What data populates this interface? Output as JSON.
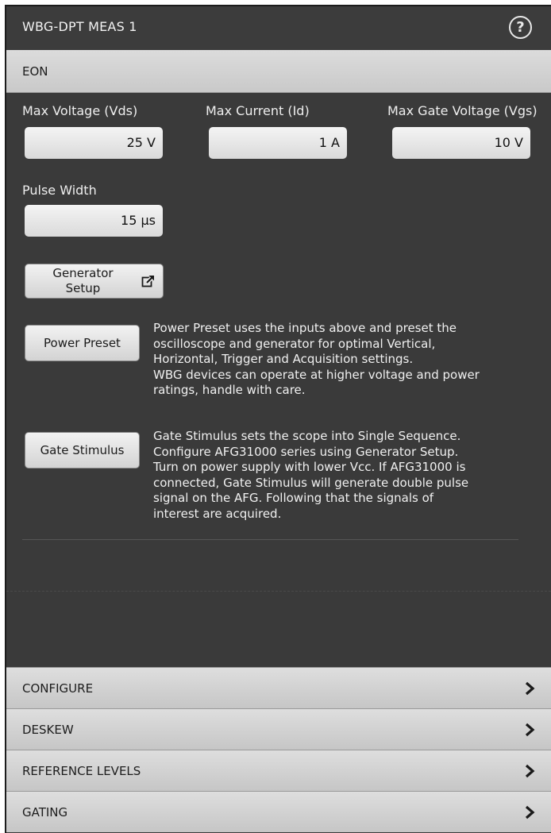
{
  "window": {
    "title": "WBG-DPT MEAS 1",
    "help_icon": "help-circle-icon"
  },
  "section": {
    "title": "EON"
  },
  "fields": {
    "max_voltage": {
      "label": "Max Voltage (Vds)",
      "value": "25 V"
    },
    "max_current": {
      "label": "Max Current (Id)",
      "value": "1 A"
    },
    "max_gate_voltage": {
      "label": "Max Gate Voltage (Vgs)",
      "value": "10 V"
    },
    "pulse_width": {
      "label": "Pulse Width",
      "value": "15 µs"
    }
  },
  "buttons": {
    "generator_setup": {
      "line1": "Generator",
      "line2": "Setup",
      "icon": "external-link-icon"
    },
    "power_preset": {
      "label": "Power Preset"
    },
    "gate_stimulus": {
      "label": "Gate Stimulus"
    }
  },
  "descriptions": {
    "power_preset": [
      "Power Preset uses the inputs above and preset the",
      "oscilloscope and generator for optimal Vertical,",
      "Horizontal, Trigger and Acquisition settings.",
      "WBG devices can operate at higher voltage and power",
      "ratings, handle with care."
    ],
    "gate_stimulus": [
      "Gate Stimulus sets the scope into Single Sequence.",
      "Configure AFG31000 series using Generator Setup.",
      "Turn on power supply with lower Vcc. If AFG31000 is",
      "connected, Gate Stimulus will generate double pulse",
      "signal on the AFG. Following that the signals of",
      "interest are acquired."
    ]
  },
  "accordion": [
    {
      "label": "CONFIGURE",
      "icon": "chevron-right-icon"
    },
    {
      "label": "DESKEW",
      "icon": "chevron-right-icon"
    },
    {
      "label": "REFERENCE LEVELS",
      "icon": "chevron-right-icon"
    },
    {
      "label": "GATING",
      "icon": "chevron-right-icon"
    }
  ],
  "colors": {
    "panel_background": "#3a3a3a",
    "header_background": "#3c3c3c",
    "section_header": "#d4d4d4",
    "field_background": "#e8e8e8"
  }
}
